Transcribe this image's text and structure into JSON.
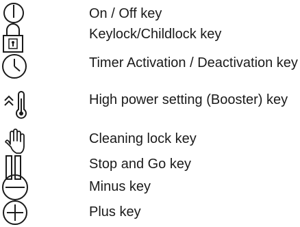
{
  "legend": {
    "items": [
      {
        "id": "on-off",
        "icon": "power-icon",
        "label": "On / Off key"
      },
      {
        "id": "keylock",
        "icon": "padlock-icon",
        "label": "Keylock/Childlock key"
      },
      {
        "id": "timer",
        "icon": "clock-icon",
        "label": "Timer Activation / Deactivation key"
      },
      {
        "id": "booster",
        "icon": "booster-thermometer-icon",
        "label": "High power setting (Booster) key"
      },
      {
        "id": "cleaning-lock",
        "icon": "hand-icon",
        "label": "Cleaning lock key"
      },
      {
        "id": "stop-go",
        "icon": "pause-icon",
        "label": "Stop and Go key"
      },
      {
        "id": "minus",
        "icon": "minus-circle-icon",
        "label": "Minus key"
      },
      {
        "id": "plus",
        "icon": "plus-circle-icon",
        "label": "Plus key"
      }
    ]
  },
  "colors": {
    "text": "#1a1a1a",
    "icon_stroke": "#1a1a1a",
    "background": "#ffffff"
  }
}
